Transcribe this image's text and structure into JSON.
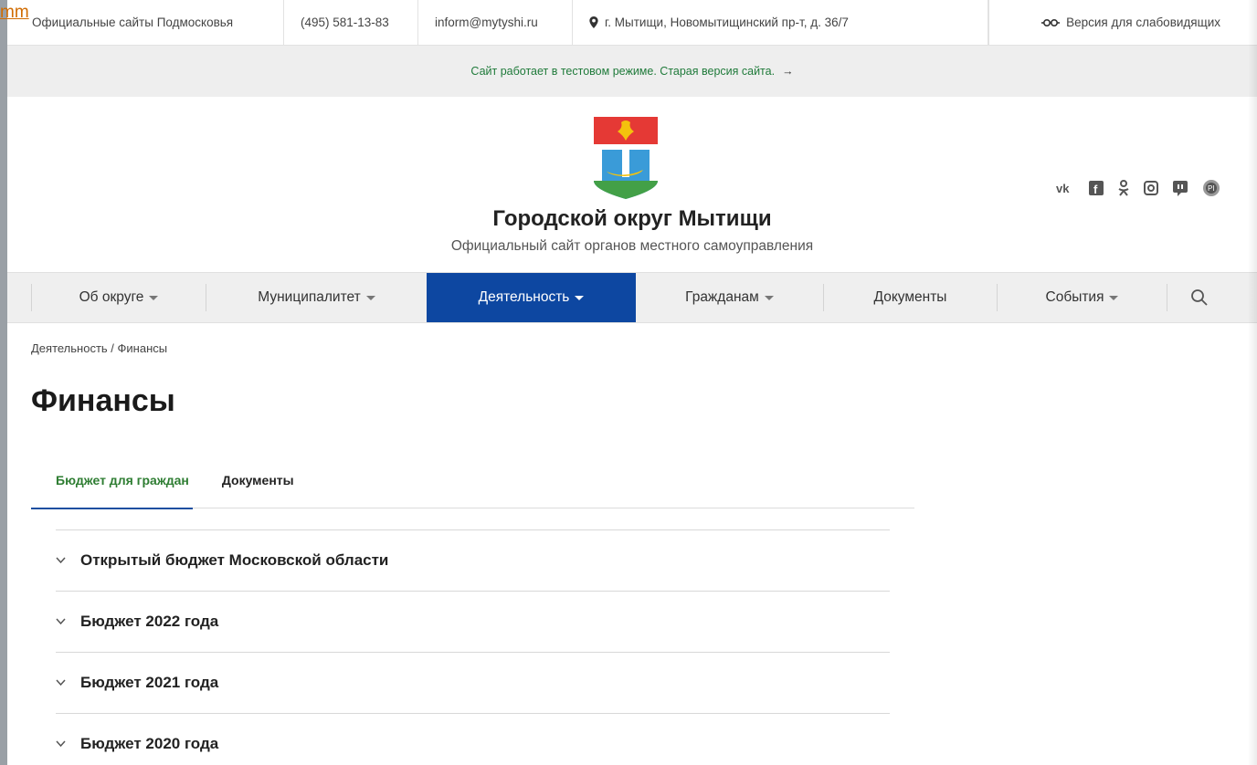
{
  "corner_link": "mm",
  "topbar": {
    "sites": "Официальные сайты Подмосковья",
    "phone": "(495) 581-13-83",
    "email": "inform@mytyshi.ru",
    "address": "г. Мытищи, Новомытищинский пр-т, д. 36/7",
    "accessibility": "Версия для слабовидящих"
  },
  "notice": {
    "text": "Сайт работает в тестовом режиме. Старая версия сайта.",
    "arrow": "→"
  },
  "header": {
    "title": "Городской округ Мытищи",
    "subtitle": "Официальный сайт органов местного самоуправления",
    "social": [
      "vk-icon",
      "facebook-icon",
      "odnoklassniki-icon",
      "instagram-icon",
      "telegram-icon",
      "pi-icon"
    ]
  },
  "nav": {
    "items": [
      {
        "label": "Об округе"
      },
      {
        "label": "Муниципалитет"
      },
      {
        "label": "Деятельность"
      },
      {
        "label": "Гражданам"
      },
      {
        "label": "Документы"
      },
      {
        "label": "События"
      }
    ],
    "active_color": "#0d47a1"
  },
  "breadcrumb": "Деятельность / Финансы",
  "page_title": "Финансы",
  "tabs": [
    {
      "label": "Бюджет для граждан"
    },
    {
      "label": "Документы"
    }
  ],
  "accordion": [
    {
      "label": "Открытый бюджет Московской области"
    },
    {
      "label": "Бюджет 2022 года"
    },
    {
      "label": "Бюджет 2021 года"
    },
    {
      "label": "Бюджет 2020 года"
    }
  ]
}
